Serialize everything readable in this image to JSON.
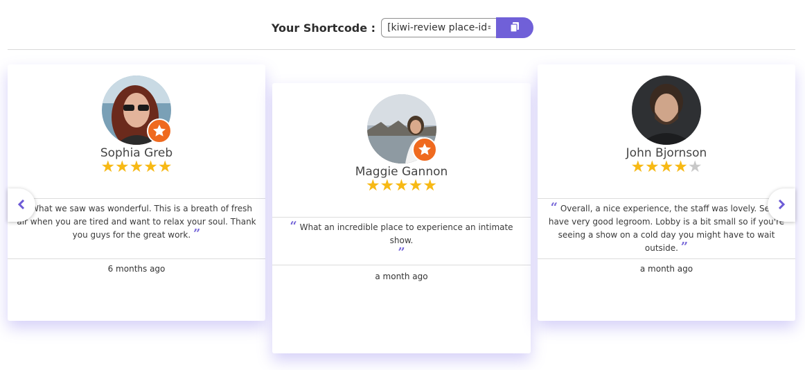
{
  "shortcode": {
    "label": "Your Shortcode :",
    "value": "[kiwi-review place-id=ChI",
    "copy_icon": "copy-icon",
    "accent": "#7060d8"
  },
  "colors": {
    "star": "#f7b915",
    "star_off": "#c8c8c8",
    "badge": "#ef6a1f",
    "quote": "#7666d8"
  },
  "reviews": [
    {
      "name": "Sophia Greb",
      "rating": 5,
      "stars": "★★★★★",
      "stars_off": "",
      "open_quote": "“",
      "text": "What we saw was wonderful. This is a breath of fresh air when you are tired and want to relax your soul. Thank you guys for the great work.",
      "close_quote": "”",
      "time": "6 months ago"
    },
    {
      "name": "Maggie Gannon",
      "rating": 5,
      "stars": "★★★★★",
      "stars_off": "",
      "open_quote": "“",
      "text": "What an incredible place to experience an intimate show.",
      "close_quote": "”",
      "time": "a month ago"
    },
    {
      "name": "John Bjornson",
      "rating": 4,
      "stars": "★★★★",
      "stars_off": "★",
      "open_quote": "“",
      "text": "Overall, a nice experience, the staff was lovely. Seats have very good legroom. Lobby is a bit small so if you're seeing a show on a cold day you might have to wait outside.",
      "close_quote": "”",
      "time": "a month ago"
    }
  ],
  "nav": {
    "prev_icon": "chevron-left-icon",
    "next_icon": "chevron-right-icon"
  }
}
